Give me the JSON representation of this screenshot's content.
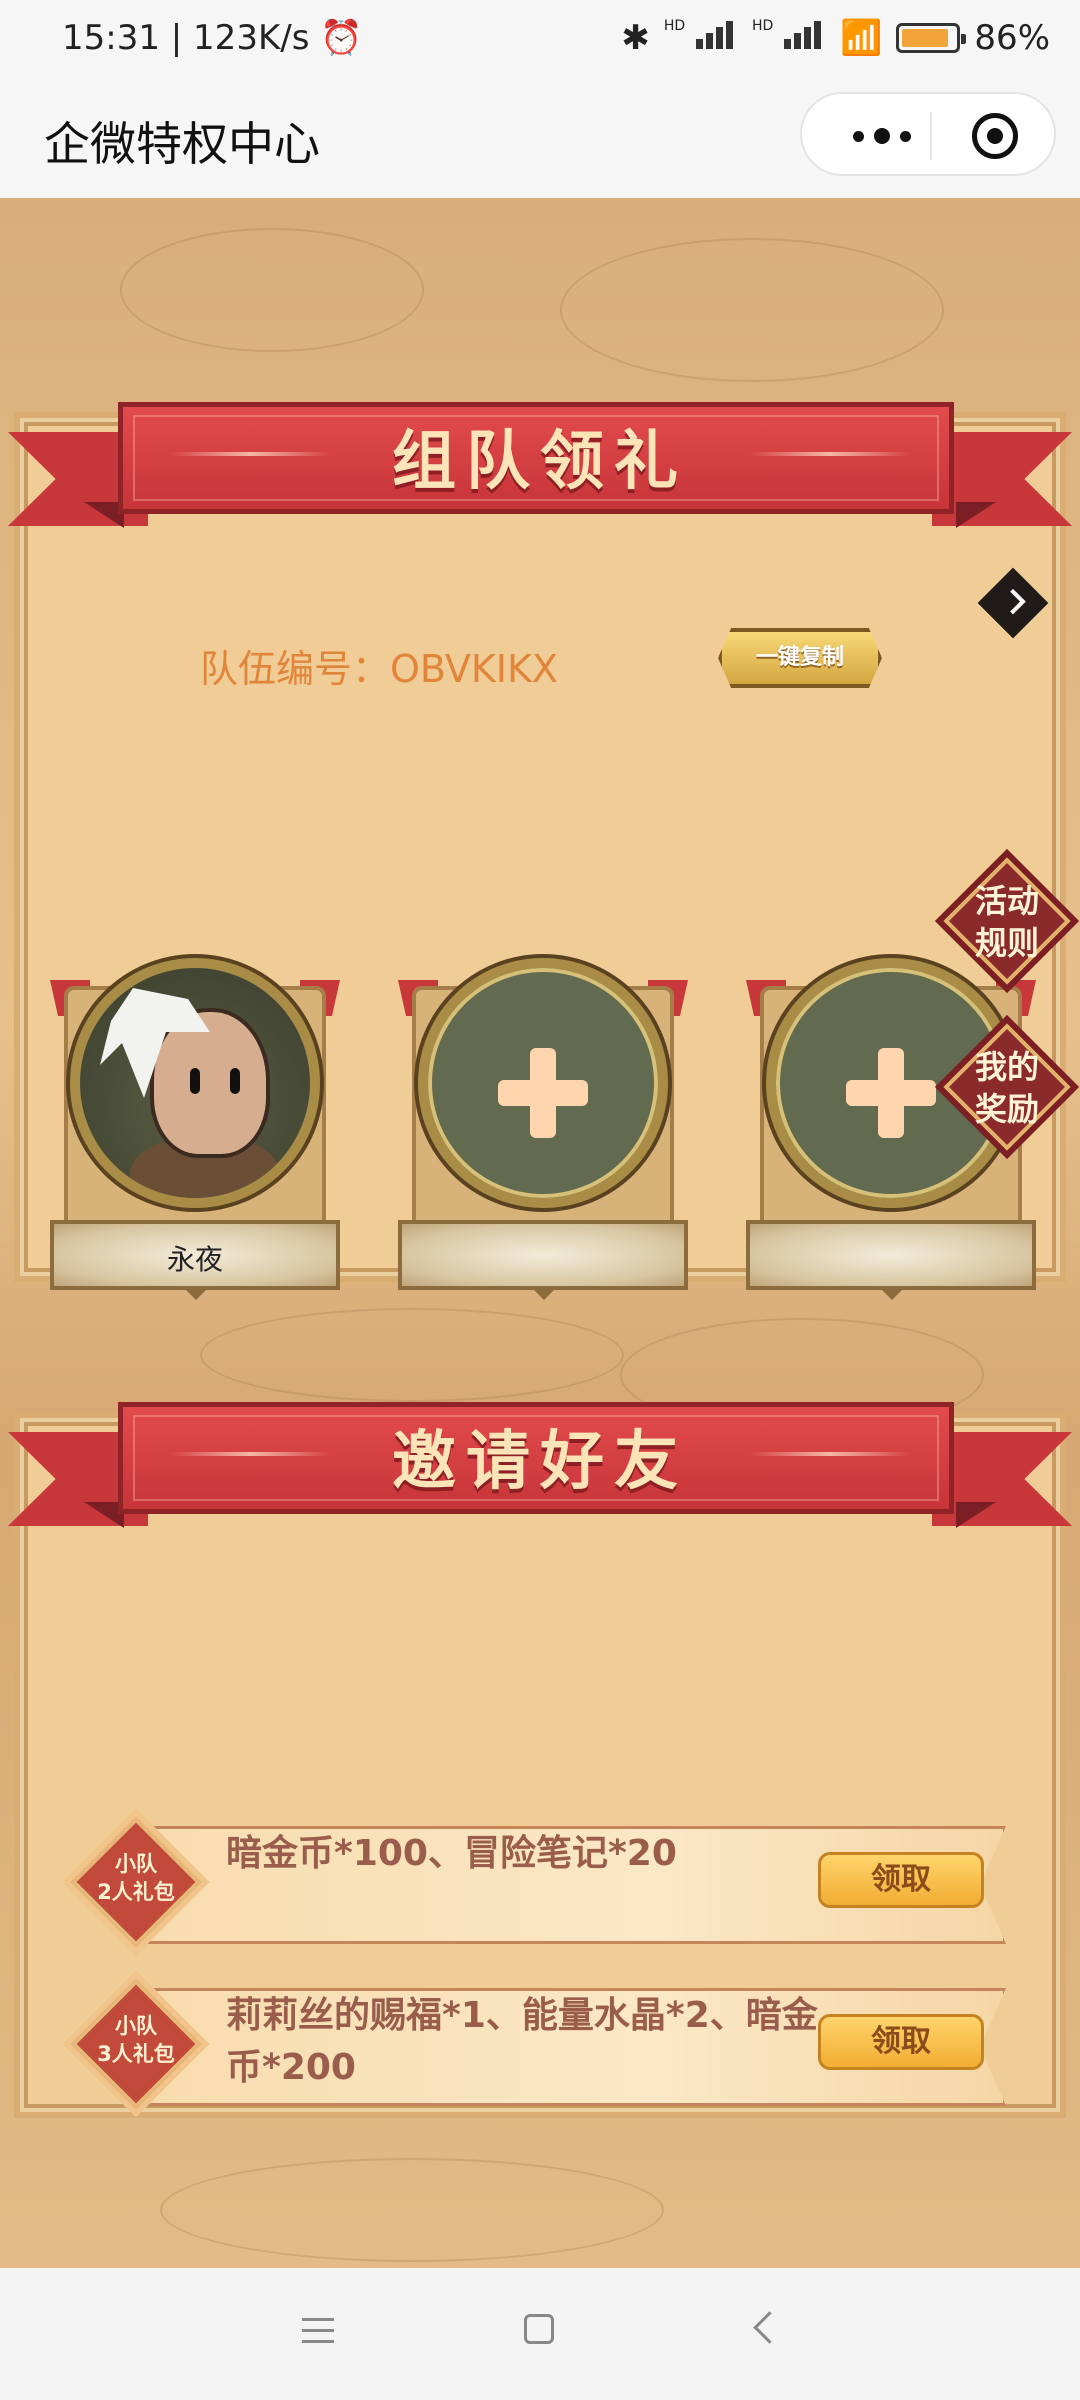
{
  "status": {
    "time_speed": "15:31 | 123K/s",
    "hd1": "HD",
    "hd2": "HD",
    "battery_percent": "86",
    "battery_level": 0.86,
    "alarm_icon": "alarm-icon",
    "bluetooth_icon": "bluetooth-icon",
    "wifi_icon": "wifi-icon"
  },
  "nav": {
    "title": "企微特权中心",
    "more_icon": "more-dots-icon",
    "close_icon": "target-icon"
  },
  "team_section": {
    "title": "组队领礼",
    "team_id_label": "队伍编号：",
    "team_id_value": "OBVKIKX",
    "copy_button": "一键复制",
    "side_rules": [
      "活动",
      "规则"
    ],
    "side_rewards": [
      "我的",
      "奖励"
    ],
    "members": [
      {
        "name": "永夜",
        "state": "filled"
      },
      {
        "name": "",
        "state": "empty"
      },
      {
        "name": "",
        "state": "empty"
      }
    ]
  },
  "invite_section": {
    "title": "邀请好友",
    "rewards": [
      {
        "badge_top": "小队",
        "badge_bottom": "2人礼包",
        "desc": "暗金币*100、冒险笔记*20",
        "action": "领取"
      },
      {
        "badge_top": "小队",
        "badge_bottom": "3人礼包",
        "desc": "莉莉丝的赐福*1、能量水晶*2、暗金币*200",
        "action": "领取"
      }
    ]
  },
  "colors": {
    "ribbon_red": "#c8383b",
    "team_id_orange": "#e1853a",
    "claim_gold": "#f2ad33",
    "panel_beige": "#f0cd97"
  }
}
